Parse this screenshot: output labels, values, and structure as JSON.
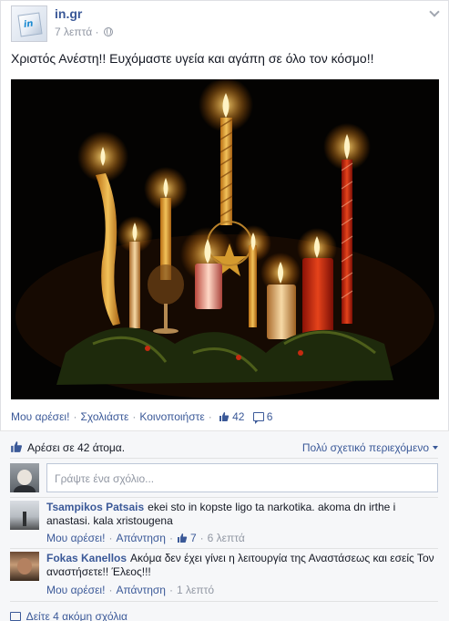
{
  "post": {
    "page_name": "in.gr",
    "avatar_logo_text": "in",
    "time": "7 λεπτά",
    "separator": "·",
    "text": "Χριστός Ανέστη!! Ευχόμαστε υγεία και αγάπη σε όλο τον κόσμο!!",
    "actions": {
      "like": "Μου αρέσει!",
      "comment": "Σχολιάστε",
      "share": "Κοινοποιήστε",
      "like_count": "42",
      "comment_count": "6",
      "sep": "·"
    }
  },
  "feedback": {
    "likes_text": "Αρέσει σε 42 άτομα.",
    "relevance": "Πολύ σχετικό περιεχόμενο",
    "comment_placeholder": "Γράψτε ένα σχόλιο...",
    "comments": [
      {
        "author": "Tsampikos Patsais",
        "text": "ekei sto in kopste ligo ta narkotika. akoma dn irthe i anastasi. kala xristougena",
        "like": "Μου αρέσει!",
        "reply": "Απάντηση",
        "likes": "7",
        "time": "6 λεπτά"
      },
      {
        "author": "Fokas Kanellos",
        "text": "Ακόμα δεν έχει γίνει η λειτουργία της Αναστάσεως και εσείς Τον αναστήσετε!! Έλεος!!!",
        "like": "Μου αρέσει!",
        "reply": "Απάντηση",
        "time": "1 λεπτό"
      }
    ],
    "more_comments": "Δείτε 4 ακόμη σχόλια"
  },
  "colors": {
    "link": "#3b5998",
    "muted": "#9197a3",
    "feedback_bg": "#f6f7f9"
  }
}
